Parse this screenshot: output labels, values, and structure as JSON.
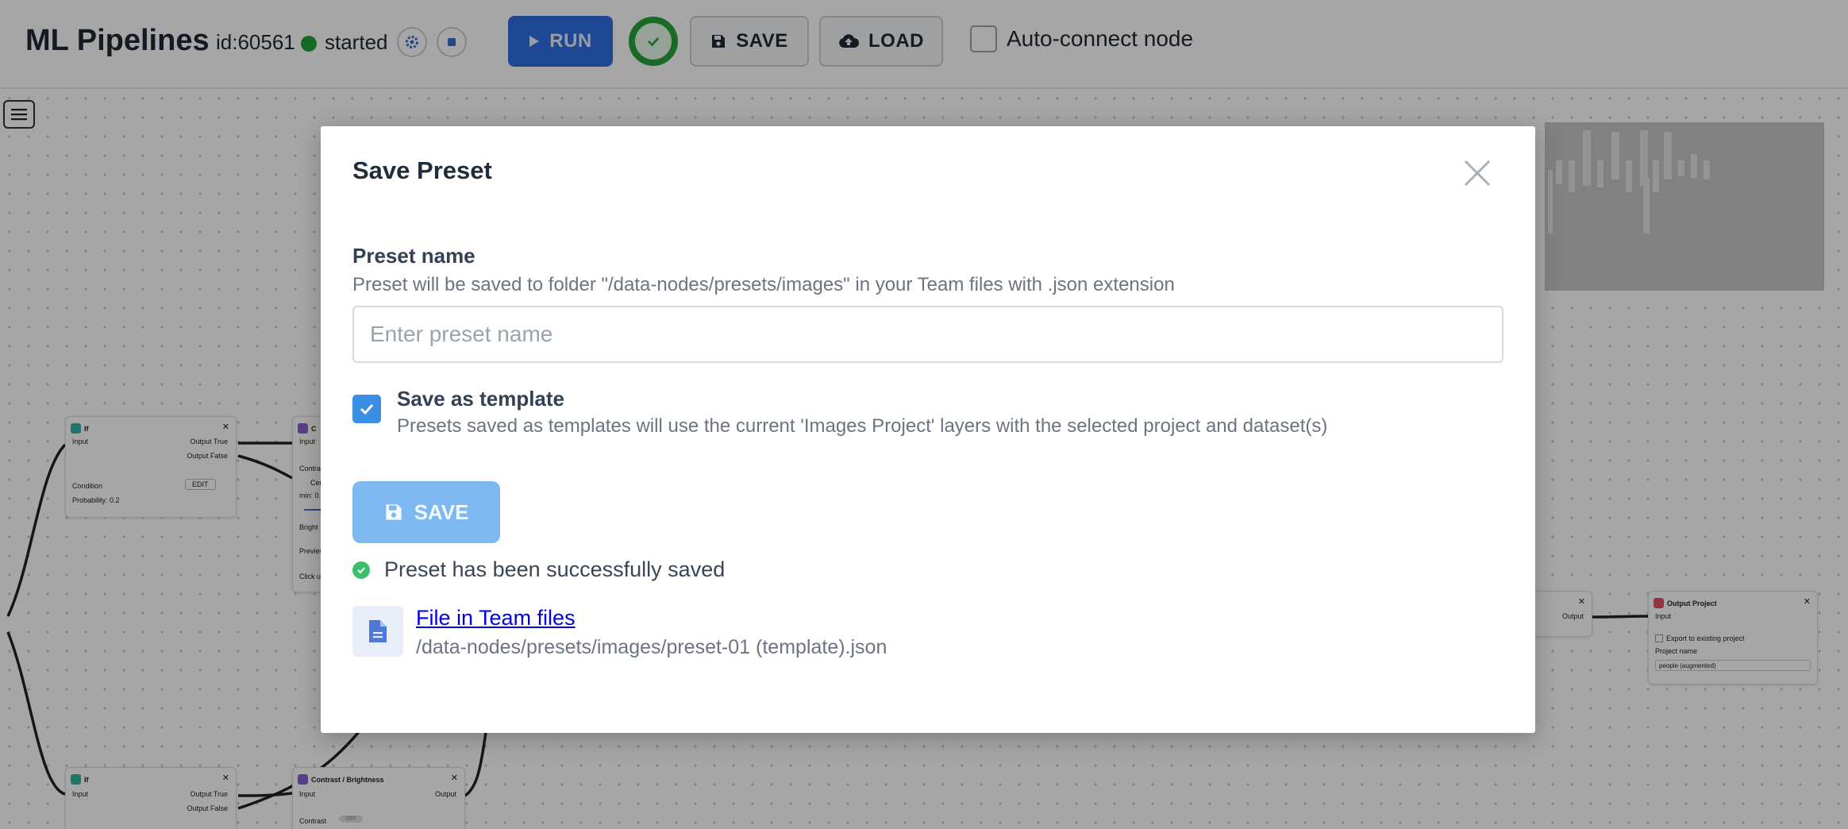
{
  "header": {
    "app_title": "ML Pipelines",
    "task_id": "id:60561",
    "status": "started",
    "run_label": "RUN",
    "save_label": "SAVE",
    "load_label": "LOAD",
    "auto_connect_label": "Auto-connect node",
    "auto_connect_checked": false
  },
  "canvas": {
    "nodes": {
      "if_top": {
        "title": "If",
        "in": "Input",
        "out_true": "Output True",
        "out_false": "Output False",
        "condition": "Condition",
        "edit": "EDIT",
        "probability": "Probability: 0.2"
      },
      "if_bottom": {
        "title": "If",
        "in": "Input",
        "out_true": "Output True",
        "out_false": "Output False"
      },
      "contrast_top": {
        "title": "C",
        "in": "Input",
        "r1": "Contra",
        "r2": "Cen",
        "r3": "min: 0.4",
        "r4": "Bright",
        "r5": "Preview",
        "r6": "Click u"
      },
      "contrast_bottom": {
        "title": "Contrast / Brightness",
        "in": "Input",
        "out": "Output",
        "contrast": "Contrast",
        "toggle": "OFF"
      },
      "output_project": {
        "title": "Output Project",
        "in": "Input",
        "export": "Export to existing project",
        "project_name_label": "Project name",
        "project_name_value": "people (augmented)"
      },
      "mid_right": {
        "out": "Output"
      }
    }
  },
  "modal": {
    "title": "Save Preset",
    "preset_name_label": "Preset name",
    "preset_name_desc": "Preset will be saved to folder \"/data-nodes/presets/images\" in your Team files with .json extension",
    "preset_name_placeholder": "Enter preset name",
    "preset_name_value": "",
    "template_label": "Save as template",
    "template_checked": true,
    "template_desc": "Presets saved as templates will use the current 'Images Project' layers with the selected project and dataset(s)",
    "save_label": "SAVE",
    "success_message": "Preset has been successfully saved",
    "file_link": "File in Team files",
    "file_path": "/data-nodes/presets/images/preset-01 (template).json"
  }
}
